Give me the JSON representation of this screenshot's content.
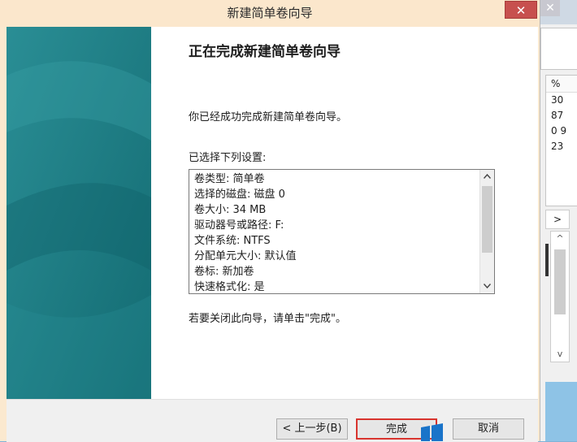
{
  "background_window": {
    "close_glyph": "✕",
    "column_header": "%",
    "values": [
      "30",
      "87",
      "0 9",
      "23"
    ],
    "scroll_right_glyph": ">",
    "scroll_up_glyph": "^",
    "scroll_down_glyph": "v"
  },
  "dialog": {
    "title": "新建简单卷向导",
    "close_glyph": "✕",
    "heading": "正在完成新建简单卷向导",
    "success_text": "你已经成功完成新建简单卷向导。",
    "settings_label": "已选择下列设置:",
    "settings": [
      "卷类型: 简单卷",
      "选择的磁盘: 磁盘 0",
      "卷大小: 34 MB",
      "驱动器号或路径: F:",
      "文件系统: NTFS",
      "分配单元大小: 默认值",
      "卷标: 新加卷",
      "快速格式化: 是"
    ],
    "close_hint": "若要关闭此向导，请单击\"完成\"。",
    "buttons": {
      "back": "< 上一步(B)",
      "finish": "完成",
      "cancel": "取消"
    }
  },
  "colors": {
    "banner": "#1d7f86",
    "title_bar": "#fbe7cc",
    "close_button": "#c7504e",
    "highlight": "#d8342e"
  }
}
